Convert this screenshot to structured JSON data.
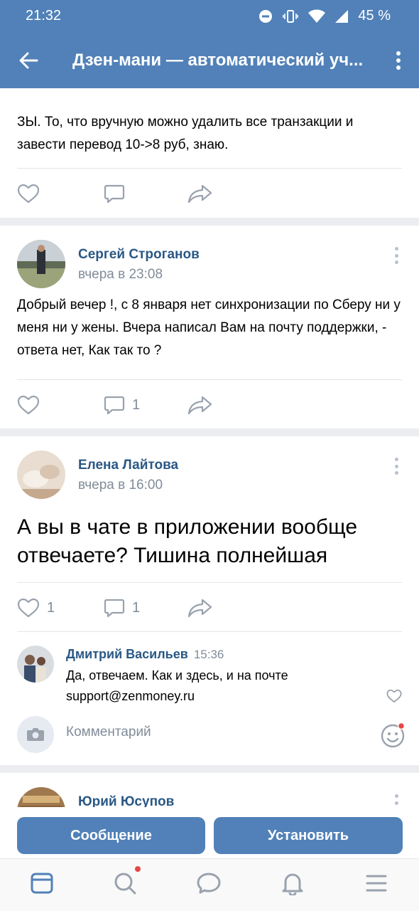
{
  "status_bar": {
    "time": "21:32",
    "battery": "45 %"
  },
  "header": {
    "title": "Дзен-мани — автоматический уч..."
  },
  "posts": [
    {
      "text": "ЗЫ. То, что вручную можно удалить все транзакции и завести перевод 10->8 руб, знаю.",
      "likes": "",
      "comments": ""
    },
    {
      "author": "Сергей Строганов",
      "date": "вчера в 23:08",
      "text": "Добрый вечер !, с 8 января нет синхронизации по Сберу ни у меня ни у жены. Вчера написал Вам на почту поддержки, - ответа нет, Как так то ?",
      "likes": "",
      "comments": "1"
    },
    {
      "author": "Елена Лайтова",
      "date": "вчера в 16:00",
      "text": "А вы в чате в приложении вообще отвечаете? Тишина полнейшая",
      "likes": "1",
      "comments": "1",
      "comment": {
        "author": "Дмитрий Васильев",
        "time": "15:36",
        "text": "Да, отвечаем. Как и здесь, и на почте support@zenmoney.ru"
      },
      "comment_placeholder": "Комментарий"
    },
    {
      "author": "Юрий Юсупов"
    }
  ],
  "buttons": {
    "message": "Сообщение",
    "install": "Установить"
  },
  "icons": {
    "back": "arrow-left-icon",
    "more": "more-vertical-icon",
    "like": "heart-icon",
    "comment": "comment-icon",
    "share": "share-icon",
    "camera": "camera-icon",
    "emoji": "smile-icon",
    "news": "news-tab-icon",
    "search": "search-tab-icon",
    "messages": "messages-tab-icon",
    "notifications": "bell-tab-icon",
    "menu": "menu-tab-icon"
  },
  "colors": {
    "header": "#5181b8",
    "link": "#2a5885",
    "secondary": "#818c99",
    "badge": "#e64646"
  }
}
